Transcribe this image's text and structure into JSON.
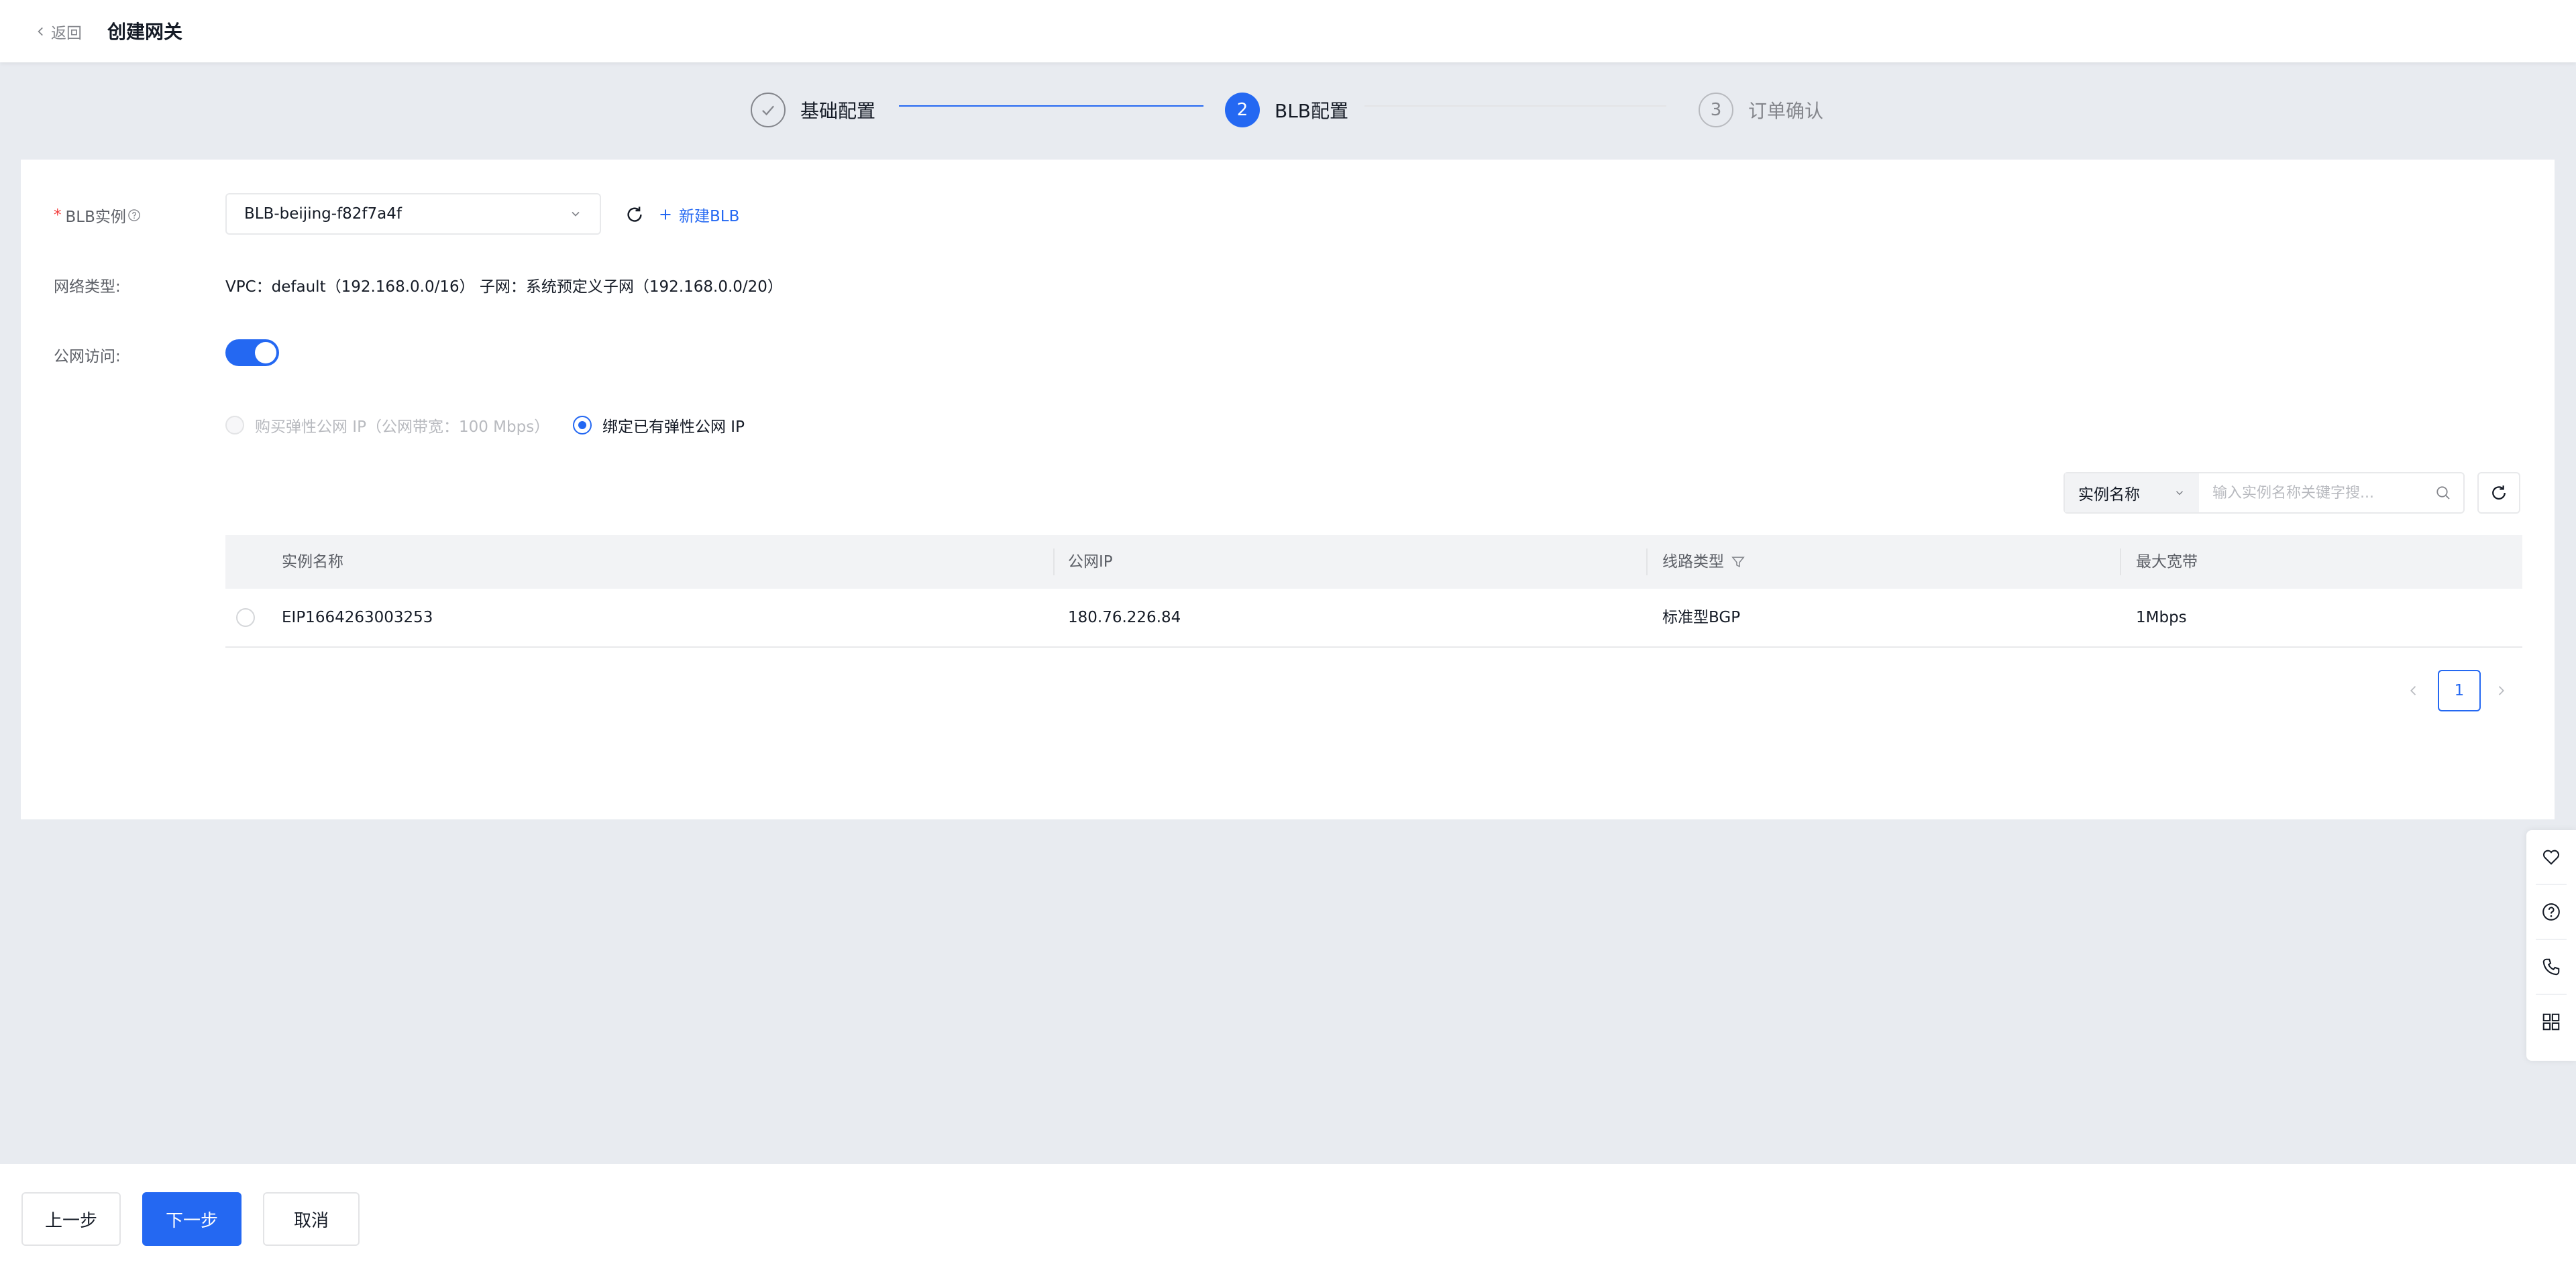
{
  "header": {
    "back_label": "返回",
    "title": "创建网关"
  },
  "steps": [
    {
      "index": "1",
      "label": "基础配置",
      "state": "done"
    },
    {
      "index": "2",
      "label": "BLB配置",
      "state": "active"
    },
    {
      "index": "3",
      "label": "订单确认",
      "state": "wait"
    }
  ],
  "form": {
    "blb_label": "BLB实例",
    "blb_required_mark": "*",
    "blb_selected": "BLB-beijing-f82f7a4f",
    "new_blb_label": "新建BLB",
    "network_label": "网络类型:",
    "network_value": "VPC：default（192.168.0.0/16） 子网：系统预定义子网（192.168.0.0/20）",
    "public_access_label": "公网访问:",
    "public_access_on": true,
    "radio_buy_label": "购买弹性公网 IP（公网带宽：100 Mbps）",
    "radio_bind_label": "绑定已有弹性公网 IP"
  },
  "search": {
    "type_label": "实例名称",
    "placeholder": "输入实例名称关键字搜..."
  },
  "table": {
    "columns": [
      "实例名称",
      "公网IP",
      "线路类型",
      "最大宽带"
    ],
    "rows": [
      {
        "name": "EIP1664263003253",
        "ip": "180.76.226.84",
        "line": "标准型BGP",
        "bandwidth": "1Mbps"
      }
    ]
  },
  "pagination": {
    "current_page": "1"
  },
  "footer": {
    "prev_label": "上一步",
    "next_label": "下一步",
    "cancel_label": "取消"
  },
  "colors": {
    "primary": "#2468f2",
    "background": "#e8ebf0"
  },
  "side_tools": [
    "heart-icon",
    "help-icon",
    "phone-icon",
    "apps-grid-icon"
  ]
}
